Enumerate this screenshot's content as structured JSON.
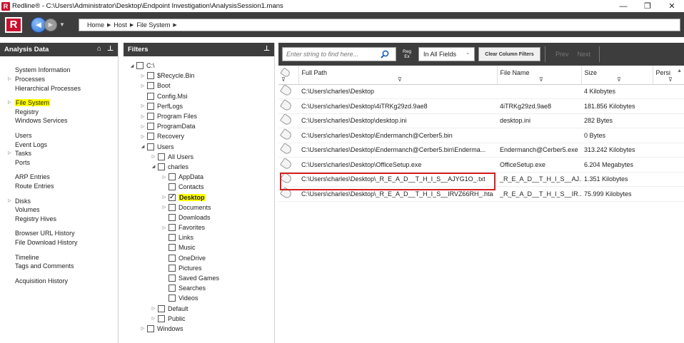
{
  "window": {
    "title": "Redline® - C:\\Users\\Administrator\\Desktop\\Endpoint Investigation\\AnalysisSession1.mans",
    "logo_letter": "R",
    "minimize": "—",
    "maximize": "❐",
    "close": "✕"
  },
  "toolbar": {
    "breadcrumb": [
      "Home",
      "Host",
      "File System"
    ]
  },
  "left_panel": {
    "title": "Analysis Data",
    "groups": [
      [
        {
          "label": "System Information",
          "expandable": false
        },
        {
          "label": "Processes",
          "expandable": true
        },
        {
          "label": "Hierarchical Processes",
          "expandable": false
        }
      ],
      [
        {
          "label": "File System",
          "expandable": true,
          "active": true
        },
        {
          "label": "Registry",
          "expandable": false
        },
        {
          "label": "Windows Services",
          "expandable": false
        }
      ],
      [
        {
          "label": "Users",
          "expandable": false
        },
        {
          "label": "Event Logs",
          "expandable": false
        },
        {
          "label": "Tasks",
          "expandable": true
        },
        {
          "label": "Ports",
          "expandable": false
        }
      ],
      [
        {
          "label": "ARP Entries",
          "expandable": false
        },
        {
          "label": "Route Entries",
          "expandable": false
        }
      ],
      [
        {
          "label": "Disks",
          "expandable": true
        },
        {
          "label": "Volumes",
          "expandable": false
        },
        {
          "label": "Registry Hives",
          "expandable": false
        }
      ],
      [
        {
          "label": "Browser URL History",
          "expandable": false
        },
        {
          "label": "File Download History",
          "expandable": false
        }
      ],
      [
        {
          "label": "Timeline",
          "expandable": false
        },
        {
          "label": "Tags and Comments",
          "expandable": false
        }
      ],
      [
        {
          "label": "Acquisition History",
          "expandable": false
        }
      ]
    ]
  },
  "filters_panel": {
    "title": "Filters",
    "tree": [
      {
        "label": "C:\\",
        "level": 0,
        "toggle": "open",
        "checked": false
      },
      {
        "label": "$Recycle.Bin",
        "level": 1,
        "toggle": "closed",
        "checked": false
      },
      {
        "label": "Boot",
        "level": 1,
        "toggle": "closed",
        "checked": false
      },
      {
        "label": "Config.Msi",
        "level": 1,
        "toggle": "none",
        "checked": false
      },
      {
        "label": "PerfLogs",
        "level": 1,
        "toggle": "closed",
        "checked": false
      },
      {
        "label": "Program Files",
        "level": 1,
        "toggle": "closed",
        "checked": false
      },
      {
        "label": "ProgramData",
        "level": 1,
        "toggle": "closed",
        "checked": false
      },
      {
        "label": "Recovery",
        "level": 1,
        "toggle": "closed",
        "checked": false
      },
      {
        "label": "Users",
        "level": 1,
        "toggle": "open",
        "checked": false
      },
      {
        "label": "All Users",
        "level": 2,
        "toggle": "closed",
        "checked": false
      },
      {
        "label": "charles",
        "level": 2,
        "toggle": "open",
        "checked": false
      },
      {
        "label": "AppData",
        "level": 3,
        "toggle": "closed",
        "checked": false
      },
      {
        "label": "Contacts",
        "level": 3,
        "toggle": "none",
        "checked": false
      },
      {
        "label": "Desktop",
        "level": 3,
        "toggle": "closed",
        "checked": true,
        "highlight": true
      },
      {
        "label": "Documents",
        "level": 3,
        "toggle": "closed",
        "checked": false
      },
      {
        "label": "Downloads",
        "level": 3,
        "toggle": "none",
        "checked": false
      },
      {
        "label": "Favorites",
        "level": 3,
        "toggle": "closed",
        "checked": false
      },
      {
        "label": "Links",
        "level": 3,
        "toggle": "none",
        "checked": false
      },
      {
        "label": "Music",
        "level": 3,
        "toggle": "none",
        "checked": false
      },
      {
        "label": "OneDrive",
        "level": 3,
        "toggle": "none",
        "checked": false
      },
      {
        "label": "Pictures",
        "level": 3,
        "toggle": "none",
        "checked": false
      },
      {
        "label": "Saved Games",
        "level": 3,
        "toggle": "none",
        "checked": false
      },
      {
        "label": "Searches",
        "level": 3,
        "toggle": "none",
        "checked": false
      },
      {
        "label": "Videos",
        "level": 3,
        "toggle": "none",
        "checked": false
      },
      {
        "label": "Default",
        "level": 2,
        "toggle": "closed",
        "checked": false
      },
      {
        "label": "Public",
        "level": 2,
        "toggle": "closed",
        "checked": false
      },
      {
        "label": "Windows",
        "level": 1,
        "toggle": "closed",
        "checked": false
      }
    ]
  },
  "grid": {
    "search_placeholder": "Enter string to find here...",
    "regex_label": "Reg Ex",
    "field_select": "In All Fields",
    "clear_filters": "Clear Column Filters",
    "prev": "Prev",
    "next": "Next",
    "columns": [
      "Full Path",
      "File Name",
      "Size",
      "Persi"
    ],
    "rows": [
      [
        "C:\\Users\\charles\\Desktop",
        "",
        "4 Kilobytes"
      ],
      [
        "C:\\Users\\charles\\Desktop\\4iTRKg29zd.9ae8",
        "4iTRKg29zd.9ae8",
        "181.856 Kilobytes"
      ],
      [
        "C:\\Users\\charles\\Desktop\\desktop.ini",
        "desktop.ini",
        "282 Bytes"
      ],
      [
        "C:\\Users\\charles\\Desktop\\Endermanch@Cerber5.bin",
        "",
        "0 Bytes"
      ],
      [
        "C:\\Users\\charles\\Desktop\\Endermanch@Cerber5.bin\\Enderma...",
        "Endermanch@Cerber5.exe",
        "313.242 Kilobytes"
      ],
      [
        "C:\\Users\\charles\\Desktop\\OfficeSetup.exe",
        "OfficeSetup.exe",
        "6.204 Megabytes"
      ],
      [
        "C:\\Users\\charles\\Desktop\\_R_E_A_D__T_H_I_S__AJYG1O_.txt",
        "_R_E_A_D__T_H_I_S__AJ...",
        "1.351 Kilobytes"
      ],
      [
        "C:\\Users\\charles\\Desktop\\_R_E_A_D__T_H_I_S__IRVZ66RH_.hta",
        "_R_E_A_D__T_H_I_S__IR...",
        "75.999 Kilobytes"
      ]
    ]
  }
}
